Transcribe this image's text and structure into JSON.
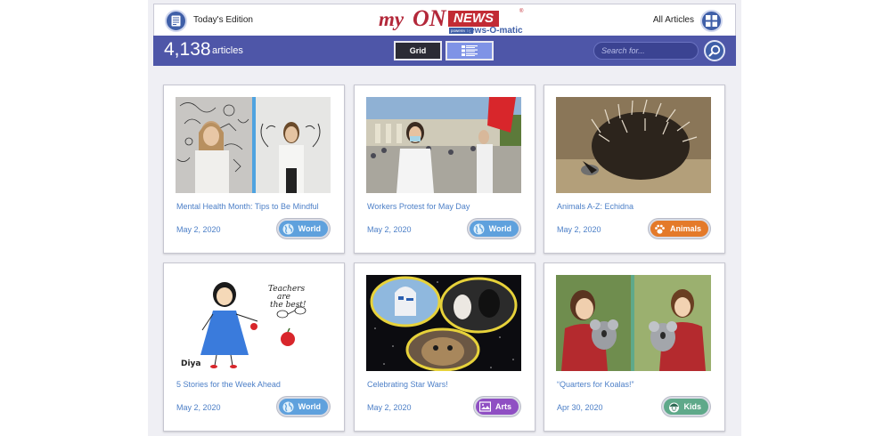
{
  "header": {
    "today_label": "Today's Edition",
    "all_articles_label": "All Articles",
    "logo": {
      "my": "my",
      "on": "ON",
      "news": "NEWS",
      "registered": "®",
      "powered_by": "powered by",
      "news_o_matic": "news-O-matic"
    }
  },
  "toolbar": {
    "article_count": "4,138",
    "article_count_label": "articles",
    "grid_label": "Grid",
    "search_placeholder": "Search for..."
  },
  "colors": {
    "toolbar": "#4e56a8",
    "link": "#4c7fc7",
    "world": "#5fa1dd",
    "animals": "#e47a2a",
    "arts": "#8f4fc3",
    "kids": "#5fa98a"
  },
  "articles": [
    {
      "title": "Mental Health Month: Tips to Be Mindful",
      "date": "May 2, 2020",
      "category": "World",
      "category_icon": "globe-icon"
    },
    {
      "title": "Workers Protest for May Day",
      "date": "May 2, 2020",
      "category": "World",
      "category_icon": "globe-icon"
    },
    {
      "title": "Animals A-Z: Echidna",
      "date": "May 2, 2020",
      "category": "Animals",
      "category_icon": "paw-icon"
    },
    {
      "title": "5 Stories for the Week Ahead",
      "date": "May 2, 2020",
      "category": "World",
      "category_icon": "globe-icon"
    },
    {
      "title": "Celebrating Star Wars!",
      "date": "May 2, 2020",
      "category": "Arts",
      "category_icon": "picture-icon"
    },
    {
      "title": "“Quarters for Koalas!”",
      "date": "Apr 30, 2020",
      "category": "Kids",
      "category_icon": "kid-face-icon"
    }
  ],
  "drawing": {
    "teachers_text_1": "Teachers",
    "teachers_text_2": "are",
    "teachers_text_3": "the best!",
    "signature": "Diya"
  }
}
